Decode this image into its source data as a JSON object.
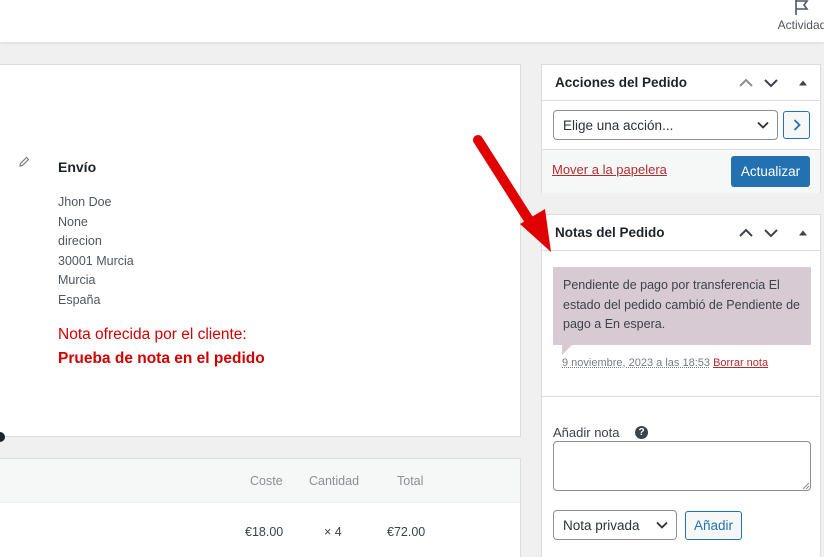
{
  "topbar": {
    "activity_label": "Actividad",
    "activity_icon": "flag-icon"
  },
  "shipping": {
    "title": "Envío",
    "address_lines": [
      "Jhon Doe",
      "None",
      "direcion",
      "30001 Murcia",
      "Murcia",
      "España"
    ],
    "customer_note_label": "Nota ofrecida por el cliente:",
    "customer_note": "Prueba de nota en el pedido"
  },
  "items": {
    "headers": {
      "cost": "Coste",
      "quantity": "Cantidad",
      "total": "Total"
    },
    "rows": [
      {
        "cost": "€18.00",
        "quantity": "× 4",
        "total": "€72.00"
      }
    ]
  },
  "order_actions": {
    "title": "Acciones del Pedido",
    "select_value": "Elige una acción...",
    "trash_link": "Mover a la papelera",
    "update_button": "Actualizar"
  },
  "order_notes": {
    "title": "Notas del Pedido",
    "notes": [
      {
        "text": "Pendiente de pago por transferencia El estado del pedido cambió de Pendiente de pago a En espera.",
        "date": "9 noviembre, 2023 a las 18:53",
        "delete_link": "Borrar nota"
      }
    ],
    "add_label": "Añadir nota",
    "help_symbol": "?",
    "note_input_value": "",
    "note_type_value": "Nota privada",
    "add_button": "Añadir"
  },
  "colors": {
    "accent": "#2271b1",
    "danger": "#b32d2e",
    "note_bubble": "#d7cad2",
    "annotation_red": "#e00000"
  }
}
